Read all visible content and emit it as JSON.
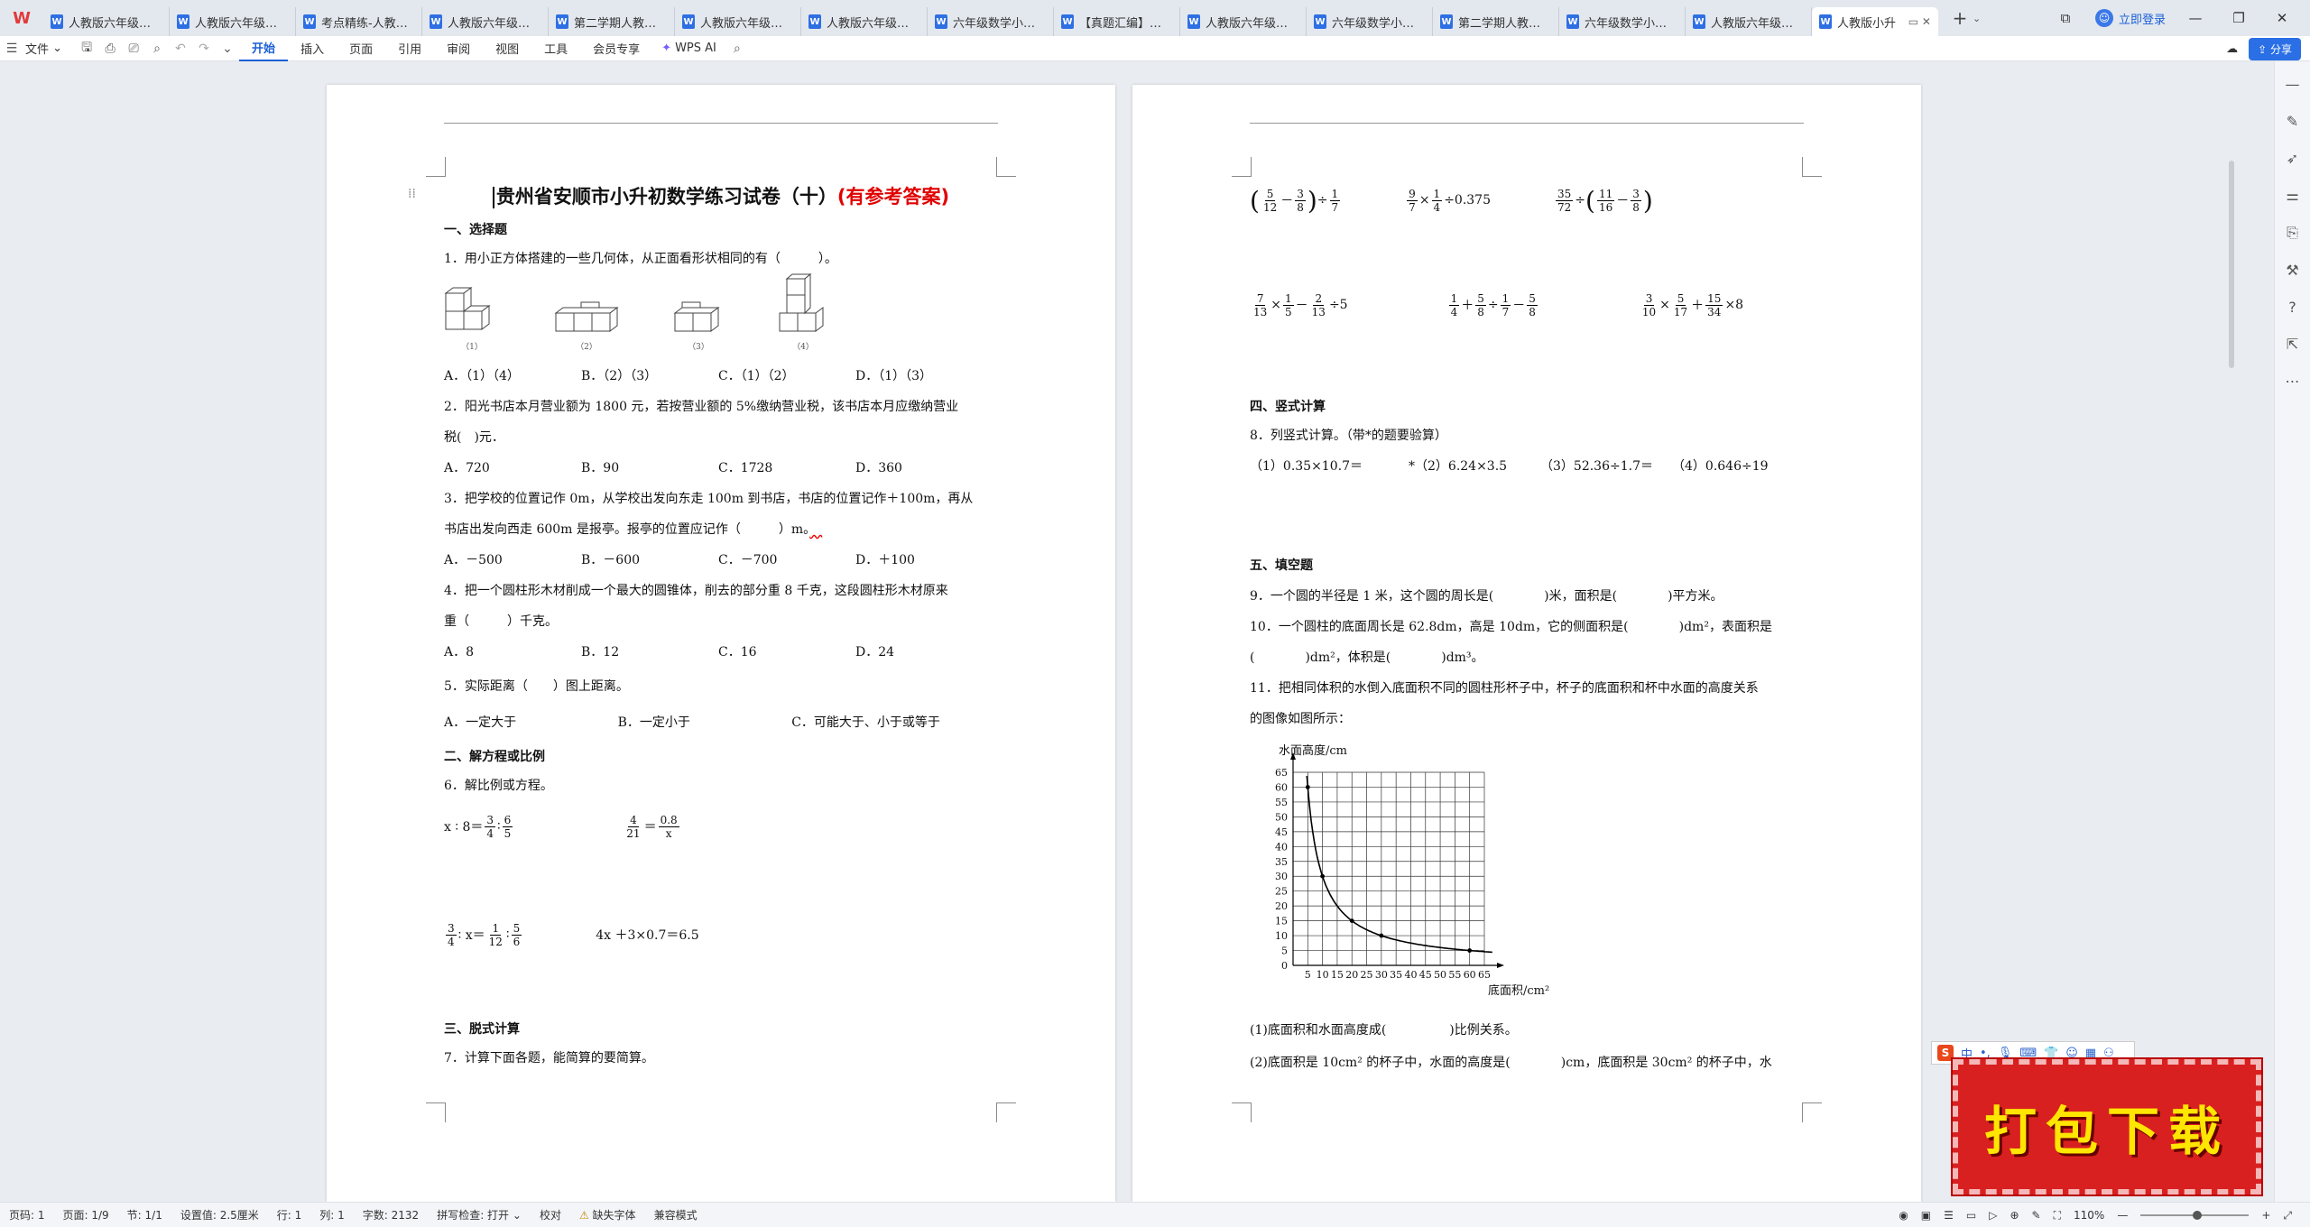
{
  "tabs": [
    {
      "label": "人教版六年级（小"
    },
    {
      "label": "人教版六年级（小"
    },
    {
      "label": "考点精练-人教版六"
    },
    {
      "label": "人教版六年级下册"
    },
    {
      "label": "第二学期人教版小"
    },
    {
      "label": "人教版六年级下册"
    },
    {
      "label": "人教版六年级下册"
    },
    {
      "label": "六年级数学小升初"
    },
    {
      "label": "【真题汇编】六年"
    },
    {
      "label": "人教版六年级下册"
    },
    {
      "label": "六年级数学小升初"
    },
    {
      "label": "第二学期人教版小"
    },
    {
      "label": "六年级数学小升初"
    },
    {
      "label": "人教版六年级下册"
    },
    {
      "label": "人教版小升"
    }
  ],
  "titlebar": {
    "login": "立即登录"
  },
  "menu": {
    "file": "文件",
    "items": [
      "开始",
      "插入",
      "页面",
      "引用",
      "审阅",
      "视图",
      "工具",
      "会员专享"
    ],
    "wps_ai": "WPS AI",
    "share": "分享"
  },
  "page1": {
    "title_main": "贵州省安顺市小升初数学练习试卷（十）",
    "title_red": "(有参考答案)",
    "sec1": "一、选择题",
    "q1": "1．用小正方体搭建的一些几何体，从正面看形状相同的有（　　　）。",
    "shape_caps": [
      "（1）",
      "（2）",
      "（3）",
      "（4）"
    ],
    "q1_opts": [
      "A．（1）（4）",
      "B．（2）（3）",
      "C．（1）（2）",
      "D．（1）（3）"
    ],
    "q2a": "2．阳光书店本月营业额为 1800 元，若按营业额的 5%缴纳营业税，该书店本月应缴纳营业",
    "q2b": "税(　)元．",
    "q2_opts": [
      "A．720",
      "B．90",
      "C．1728",
      "D．360"
    ],
    "q3a": "3．把学校的位置记作 0m，从学校出发向东走 100m 到书店，书店的位置记作＋100m，再从",
    "q3b": "书店出发向西走 600m 是报亭。报亭的位置应记作（　　　）m。",
    "q3_opts": [
      "A．－500",
      "B．－600",
      "C．－700",
      "D．＋100"
    ],
    "q4a": "4．把一个圆柱形木材削成一个最大的圆锥体，削去的部分重 8 千克，这段圆柱形木材原来",
    "q4b": "重（　　　）千克。",
    "q4_opts": [
      "A．8",
      "B．12",
      "C．16",
      "D．24"
    ],
    "q5": "5．实际距离（　　）图上距离。",
    "q5_opts": [
      "A．一定大于",
      "B．一定小于",
      "C．可能大于、小于或等于"
    ],
    "sec2": "二、解方程或比例",
    "q6": "6．解比例或方程。",
    "eq1_lhs": "x ∶ 8＝",
    "eq1_n1": "3",
    "eq1_d1": "4",
    "eq1_mid": "∶",
    "eq1_n2": "6",
    "eq1_d2": "5",
    "eq2_n1": "4",
    "eq2_d1": "21",
    "eq2_eq": "＝",
    "eq2_n2": "0.8",
    "eq2_d2": "x",
    "eq3_n1": "3",
    "eq3_d1": "4",
    "eq3_mid": "∶ x＝",
    "eq3_n2": "1",
    "eq3_d2": "12",
    "eq3_colon": "∶",
    "eq3_n3": "5",
    "eq3_d3": "6",
    "eq4": "4x ＋3×0.7＝6.5",
    "sec3": "三、脱式计算",
    "q7": "7．计算下面各题，能简算的要简算。"
  },
  "page2": {
    "c1": {
      "n1": "5",
      "d1": "12",
      "op": "－",
      "n2": "3",
      "d2": "8",
      "tail": "÷",
      "n3": "1",
      "d3": "7"
    },
    "c2": {
      "n1": "9",
      "d1": "7",
      "op": "×",
      "n2": "1",
      "d2": "4",
      "tail": "÷0.375"
    },
    "c3": {
      "n1": "35",
      "d1": "72",
      "op": "÷",
      "n2": "11",
      "d2": "16",
      "op2": "－",
      "n3": "3",
      "d3": "8"
    },
    "c4": {
      "n1": "7",
      "d1": "13",
      "op": "×",
      "n2": "1",
      "d2": "5",
      "op2": "－",
      "n3": "2",
      "d3": "13",
      "tail": "÷5"
    },
    "c5": {
      "n1": "1",
      "d1": "4",
      "op": "＋",
      "n2": "5",
      "d2": "8",
      "op2": "÷",
      "n3": "1",
      "d3": "7",
      "op3": "－",
      "n4": "5",
      "d4": "8"
    },
    "c6": {
      "n1": "3",
      "d1": "10",
      "op": "×",
      "n2": "5",
      "d2": "17",
      "op2": "＋",
      "n3": "15",
      "d3": "34",
      "tail": "×8"
    },
    "sec4": "四、竖式计算",
    "q8": "8．列竖式计算。（带*的题要验算）",
    "q8_items": [
      "（1）0.35×10.7＝",
      "*（2）6.24×3.5",
      "（3）52.36÷1.7＝",
      "（4）0.646÷19"
    ],
    "sec5": "五、填空题",
    "q9": "9．一个圆的半径是 1 米，这个圆的周长是(　　　　)米，面积是(　　　　)平方米。",
    "q10a": "10．一个圆柱的底面周长是 62.8dm，高是 10dm，它的侧面积是(　　　　)dm²，表面积是",
    "q10b": "(　　　　)dm²，体积是(　　　　)dm³。",
    "q11a": "11．把相同体积的水倒入底面积不同的圆柱形杯子中，杯子的底面积和杯中水面的高度关系",
    "q11b": "的图像如图所示：",
    "q11_1": "(1)底面积和水面高度成(　　　　　)比例关系。",
    "q11_2": "(2)底面积是 10cm² 的杯子中，水面的高度是(　　　　)cm，底面积是 30cm² 的杯子中，水"
  },
  "chart_data": {
    "type": "line",
    "title": "",
    "xlabel": "底面积/cm²",
    "ylabel": "水面高度/cm",
    "x_ticks": [
      0,
      5,
      10,
      15,
      20,
      25,
      30,
      35,
      40,
      45,
      50,
      55,
      60,
      65
    ],
    "y_ticks": [
      0,
      5,
      10,
      15,
      20,
      25,
      30,
      35,
      40,
      45,
      50,
      55,
      60,
      65
    ],
    "xlim": [
      0,
      65
    ],
    "ylim": [
      0,
      65
    ],
    "grid": true,
    "series": [
      {
        "points": [
          [
            5,
            60
          ],
          [
            10,
            30
          ],
          [
            20,
            15
          ],
          [
            30,
            10
          ],
          [
            60,
            5
          ]
        ]
      }
    ]
  },
  "statusbar": {
    "page": "页码: 1",
    "pages": "页面: 1/9",
    "section": "节: 1/1",
    "setting": "设置值: 2.5厘米",
    "row": "行: 1",
    "col": "列: 1",
    "words": "字数: 2132",
    "spell": "拼写检查: 打开",
    "proof": "校对",
    "font_missing": "缺失字体",
    "compat": "兼容模式",
    "zoom": "110%"
  },
  "ime": {
    "label": "中"
  },
  "promo": {
    "text": "打包下载"
  }
}
